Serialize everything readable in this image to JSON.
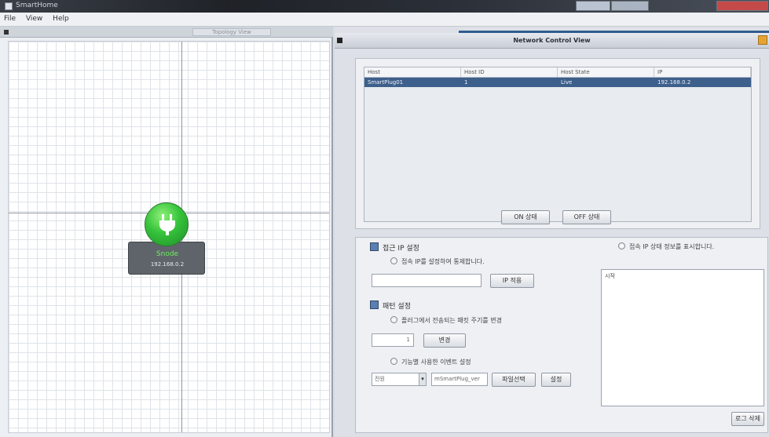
{
  "window": {
    "title": "SmartHome",
    "controls": {
      "minimize": "",
      "maximize": "",
      "close": ""
    }
  },
  "menu": [
    "File",
    "View",
    "Help"
  ],
  "topology": {
    "tab_label": "Topology View",
    "node": {
      "name": "Snode",
      "ip": "192.168.0.2"
    }
  },
  "network_view": {
    "title": "Network Control View",
    "table": {
      "columns": [
        "Host",
        "Host ID",
        "Host State",
        "IP"
      ],
      "rows": [
        [
          "SmartPlug01",
          "1",
          "Live",
          "192.168.0.2"
        ]
      ]
    },
    "buttons": {
      "on": "ON 상태",
      "off": "OFF 상태"
    },
    "ip_section": {
      "title": "접근 IP 설정",
      "radio_label": "접속 IP를 설정하여 통제합니다.",
      "ip_value": "",
      "confirm_button": "IP 적용"
    },
    "pattern_section": {
      "title": "패턴 설정",
      "radio_label": "플러그에서 전송되는 패킷 주기를 변경",
      "period_value": "1",
      "apply_button": "변경",
      "radio2_label": "기능별 사용한 이벤트 설정",
      "mode_value": "전원",
      "file_value": "mSmartPlug_ver",
      "select_button": "파일선택",
      "set_button": "설정"
    },
    "log_section": {
      "radio_label": "접속 IP 상태 정보를 표시합니다.",
      "log_text": "시작",
      "clear_button": "로그 삭제"
    }
  }
}
